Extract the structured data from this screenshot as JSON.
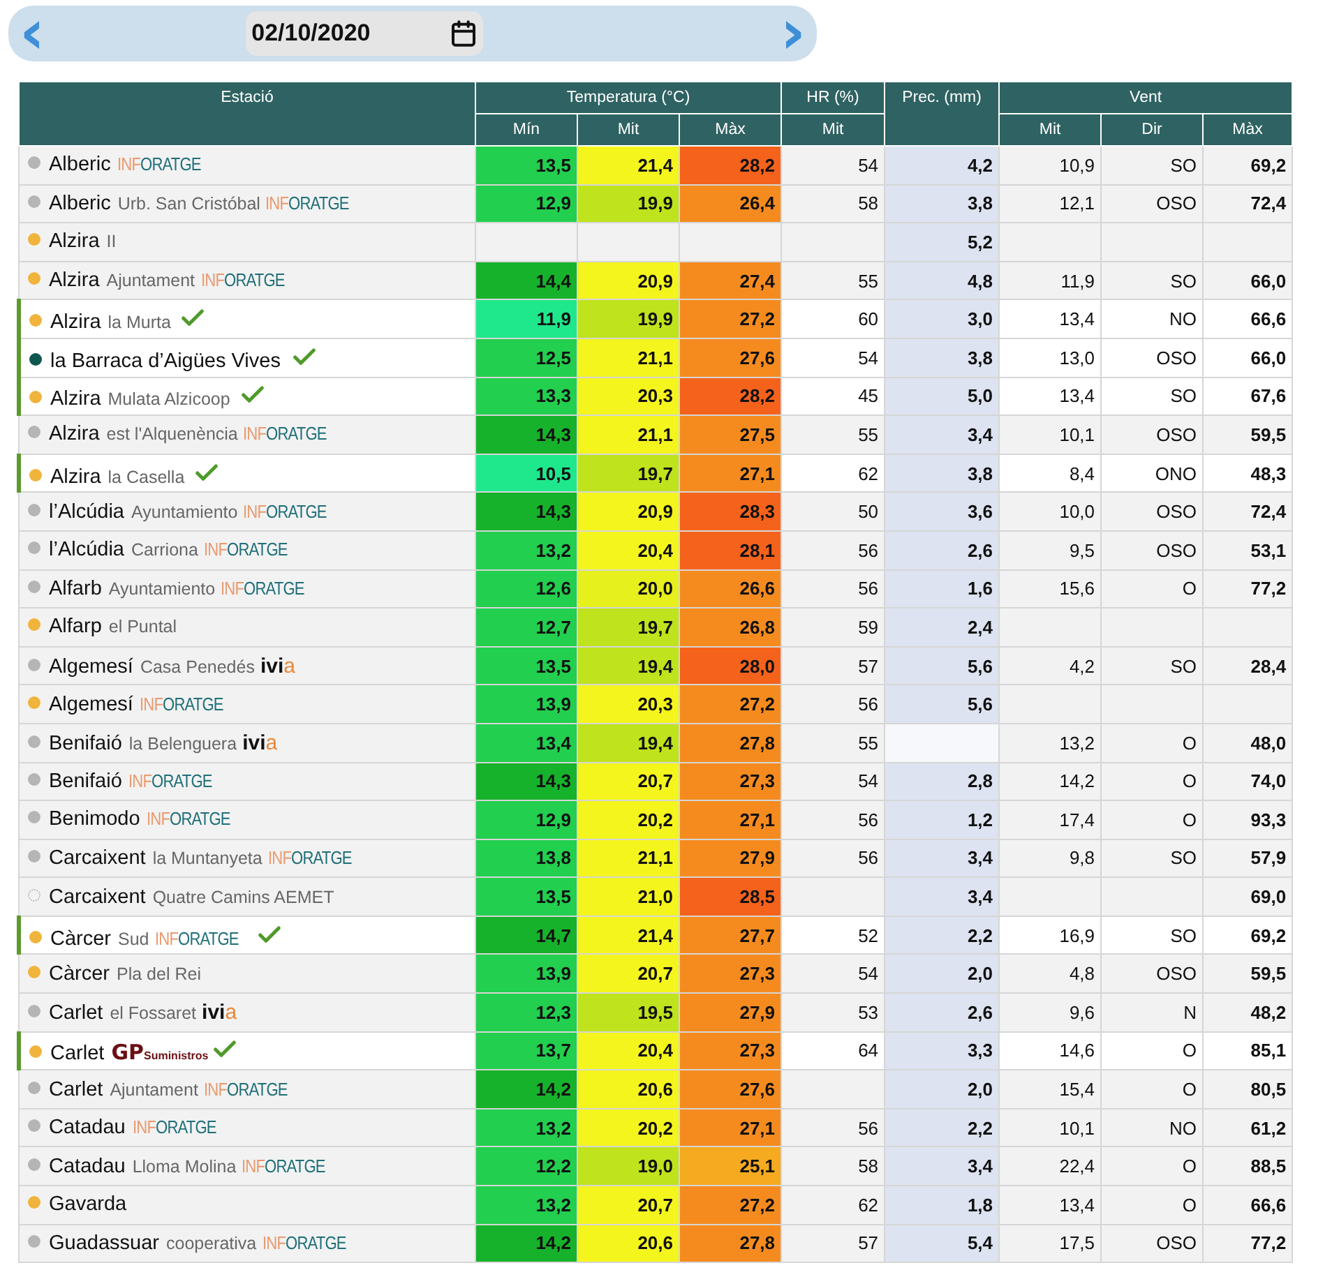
{
  "date_bar": {
    "prev": "‹",
    "date": "02/10/2020",
    "next": "›"
  },
  "table": {
    "columns": {
      "station": "Estació",
      "temperature": "Temperatura (°C)",
      "humidity": "HR (%)",
      "precipitation": "Prec. (mm)",
      "wind": "Vent",
      "sub": [
        "Mín",
        "Mit",
        "Màx",
        "Mit",
        "Mit",
        "Dir",
        "Màx"
      ]
    },
    "rows": [
      {
        "name": "Alberic",
        "place": null,
        "brand": {
          "kind": "inforatge",
          "lead": "INF",
          "rest": "ORATGE"
        },
        "color": "#b5b5b5",
        "dashed": false,
        "verified": false,
        "min": {
          "value": "13,5",
          "color": "#22cf4e"
        },
        "mit": {
          "value": "21,4",
          "color": "#f4f51c"
        },
        "max": {
          "value": "28,2",
          "color": "#f5621b"
        },
        "hr": "54",
        "prec": "4,2",
        "wind_mit": "10,9",
        "wind_dir": "SO",
        "wind_max": "69,2"
      },
      {
        "name": "Alberic",
        "place": "Urb. San Cristóbal",
        "brand": {
          "kind": "inforatge",
          "lead": "INF",
          "rest": "ORATGE"
        },
        "color": "#b5b5b5",
        "dashed": false,
        "verified": false,
        "min": {
          "value": "12,9",
          "color": "#22cf4e"
        },
        "mit": {
          "value": "19,9",
          "color": "#bfe31c"
        },
        "max": {
          "value": "26,4",
          "color": "#f58b1f"
        },
        "hr": "58",
        "prec": "3,8",
        "wind_mit": "12,1",
        "wind_dir": "OSO",
        "wind_max": "72,4"
      },
      {
        "name": "Alzira",
        "place": "II",
        "brand": null,
        "color": "#f0b43c",
        "dashed": false,
        "verified": false,
        "min": null,
        "mit": null,
        "max": null,
        "hr": null,
        "prec": "5,2",
        "wind_mit": null,
        "wind_dir": null,
        "wind_max": null
      },
      {
        "name": "Alzira",
        "place": "Ajuntament",
        "brand": {
          "kind": "inforatge",
          "lead": "INF",
          "rest": "ORATGE"
        },
        "color": "#f0b43c",
        "dashed": false,
        "verified": false,
        "min": {
          "value": "14,4",
          "color": "#17b22b"
        },
        "mit": {
          "value": "20,9",
          "color": "#f4f51c"
        },
        "max": {
          "value": "27,4",
          "color": "#f58b1f"
        },
        "hr": "55",
        "prec": "4,8",
        "wind_mit": "11,9",
        "wind_dir": "SO",
        "wind_max": "66,0"
      },
      {
        "name": "Alzira",
        "place": "la Murta",
        "brand": null,
        "color": "#f0b43c",
        "dashed": false,
        "verified": true,
        "min": {
          "value": "11,9",
          "color": "#1fe88c"
        },
        "mit": {
          "value": "19,9",
          "color": "#bfe31c"
        },
        "max": {
          "value": "27,2",
          "color": "#f58b1f"
        },
        "hr": "60",
        "prec": "3,0",
        "wind_mit": "13,4",
        "wind_dir": "NO",
        "wind_max": "66,6"
      },
      {
        "name": "la Barraca d’Aigües Vives",
        "place": null,
        "brand": null,
        "color": "#0e5550",
        "dashed": false,
        "verified": true,
        "min": {
          "value": "12,5",
          "color": "#22cf4e"
        },
        "mit": {
          "value": "21,1",
          "color": "#f4f51c"
        },
        "max": {
          "value": "27,6",
          "color": "#f58b1f"
        },
        "hr": "54",
        "prec": "3,8",
        "wind_mit": "13,0",
        "wind_dir": "OSO",
        "wind_max": "66,0"
      },
      {
        "name": "Alzira",
        "place": "Mulata Alzicoop",
        "brand": null,
        "color": "#f0b43c",
        "dashed": false,
        "verified": true,
        "min": {
          "value": "13,3",
          "color": "#22cf4e"
        },
        "mit": {
          "value": "20,3",
          "color": "#f4f51c"
        },
        "max": {
          "value": "28,2",
          "color": "#f5621b"
        },
        "hr": "45",
        "prec": "5,0",
        "wind_mit": "13,4",
        "wind_dir": "SO",
        "wind_max": "67,6"
      },
      {
        "name": "Alzira",
        "place": "est l'Alquenència",
        "brand": {
          "kind": "inforatge",
          "lead": "INF",
          "rest": "ORATGE"
        },
        "color": "#b5b5b5",
        "dashed": false,
        "verified": false,
        "min": {
          "value": "14,3",
          "color": "#17b22b"
        },
        "mit": {
          "value": "21,1",
          "color": "#f4f51c"
        },
        "max": {
          "value": "27,5",
          "color": "#f58b1f"
        },
        "hr": "55",
        "prec": "3,4",
        "wind_mit": "10,1",
        "wind_dir": "OSO",
        "wind_max": "59,5"
      },
      {
        "name": "Alzira",
        "place": "la Casella",
        "brand": null,
        "color": "#f0b43c",
        "dashed": false,
        "verified": true,
        "min": {
          "value": "10,5",
          "color": "#1fe88c"
        },
        "mit": {
          "value": "19,7",
          "color": "#bfe31c"
        },
        "max": {
          "value": "27,1",
          "color": "#f58b1f"
        },
        "hr": "62",
        "prec": "3,8",
        "wind_mit": "8,4",
        "wind_dir": "ONO",
        "wind_max": "48,3"
      },
      {
        "name": "l’Alcúdia",
        "place": "Ayuntamiento",
        "brand": {
          "kind": "inforatge",
          "lead": "INF",
          "rest": "ORATGE"
        },
        "color": "#b5b5b5",
        "dashed": false,
        "verified": false,
        "min": {
          "value": "14,3",
          "color": "#17b22b"
        },
        "mit": {
          "value": "20,9",
          "color": "#f4f51c"
        },
        "max": {
          "value": "28,3",
          "color": "#f5621b"
        },
        "hr": "50",
        "prec": "3,6",
        "wind_mit": "10,0",
        "wind_dir": "OSO",
        "wind_max": "72,4"
      },
      {
        "name": "l’Alcúdia",
        "place": "Carriona",
        "brand": {
          "kind": "inforatge",
          "lead": "INF",
          "rest": "ORATGE"
        },
        "color": "#b5b5b5",
        "dashed": false,
        "verified": false,
        "min": {
          "value": "13,2",
          "color": "#22cf4e"
        },
        "mit": {
          "value": "20,4",
          "color": "#f4f51c"
        },
        "max": {
          "value": "28,1",
          "color": "#f5621b"
        },
        "hr": "56",
        "prec": "2,6",
        "wind_mit": "9,5",
        "wind_dir": "OSO",
        "wind_max": "53,1"
      },
      {
        "name": "Alfarb",
        "place": "Ayuntamiento",
        "brand": {
          "kind": "inforatge",
          "lead": "INF",
          "rest": "ORATGE"
        },
        "color": "#b5b5b5",
        "dashed": false,
        "verified": false,
        "min": {
          "value": "12,6",
          "color": "#22cf4e"
        },
        "mit": {
          "value": "20,0",
          "color": "#e6f01c"
        },
        "max": {
          "value": "26,6",
          "color": "#f58b1f"
        },
        "hr": "56",
        "prec": "1,6",
        "wind_mit": "15,6",
        "wind_dir": "O",
        "wind_max": "77,2"
      },
      {
        "name": "Alfarp",
        "place": "el Puntal",
        "brand": null,
        "color": "#f0b43c",
        "dashed": false,
        "verified": false,
        "min": {
          "value": "12,7",
          "color": "#22cf4e"
        },
        "mit": {
          "value": "19,7",
          "color": "#bfe31c"
        },
        "max": {
          "value": "26,8",
          "color": "#f58b1f"
        },
        "hr": "59",
        "prec": "2,4",
        "wind_mit": null,
        "wind_dir": null,
        "wind_max": null
      },
      {
        "name": "Algemesí",
        "place": "Casa Penedés",
        "brand": {
          "kind": "ivia",
          "lead": "ivi",
          "rest": "a"
        },
        "color": "#b5b5b5",
        "dashed": false,
        "verified": false,
        "min": {
          "value": "13,5",
          "color": "#22cf4e"
        },
        "mit": {
          "value": "19,4",
          "color": "#bfe31c"
        },
        "max": {
          "value": "28,0",
          "color": "#f5621b"
        },
        "hr": "57",
        "prec": "5,6",
        "wind_mit": "4,2",
        "wind_dir": "SO",
        "wind_max": "28,4"
      },
      {
        "name": "Algemesí",
        "place": null,
        "brand": {
          "kind": "inforatge",
          "lead": "INF",
          "rest": "ORATGE"
        },
        "color": "#f0b43c",
        "dashed": false,
        "verified": false,
        "min": {
          "value": "13,9",
          "color": "#22cf4e"
        },
        "mit": {
          "value": "20,3",
          "color": "#f4f51c"
        },
        "max": {
          "value": "27,2",
          "color": "#f58b1f"
        },
        "hr": "56",
        "prec": "5,6",
        "wind_mit": null,
        "wind_dir": null,
        "wind_max": null
      },
      {
        "name": "Benifaió",
        "place": "la Belenguera",
        "brand": {
          "kind": "ivia",
          "lead": "ivi",
          "rest": "a"
        },
        "color": "#b5b5b5",
        "dashed": false,
        "verified": false,
        "min": {
          "value": "13,4",
          "color": "#22cf4e"
        },
        "mit": {
          "value": "19,4",
          "color": "#bfe31c"
        },
        "max": {
          "value": "27,8",
          "color": "#f58b1f"
        },
        "hr": "55",
        "prec": null,
        "wind_mit": "13,2",
        "wind_dir": "O",
        "wind_max": "48,0"
      },
      {
        "name": "Benifaió",
        "place": null,
        "brand": {
          "kind": "inforatge",
          "lead": "INF",
          "rest": "ORATGE"
        },
        "color": "#b5b5b5",
        "dashed": false,
        "verified": false,
        "min": {
          "value": "14,3",
          "color": "#17b22b"
        },
        "mit": {
          "value": "20,7",
          "color": "#f4f51c"
        },
        "max": {
          "value": "27,3",
          "color": "#f58b1f"
        },
        "hr": "54",
        "prec": "2,8",
        "wind_mit": "14,2",
        "wind_dir": "O",
        "wind_max": "74,0"
      },
      {
        "name": "Benimodo",
        "place": null,
        "brand": {
          "kind": "inforatge",
          "lead": "INF",
          "rest": "ORATGE"
        },
        "color": "#b5b5b5",
        "dashed": false,
        "verified": false,
        "min": {
          "value": "12,9",
          "color": "#22cf4e"
        },
        "mit": {
          "value": "20,2",
          "color": "#f4f51c"
        },
        "max": {
          "value": "27,1",
          "color": "#f58b1f"
        },
        "hr": "56",
        "prec": "1,2",
        "wind_mit": "17,4",
        "wind_dir": "O",
        "wind_max": "93,3"
      },
      {
        "name": "Carcaixent",
        "place": "la Muntanyeta",
        "brand": {
          "kind": "inforatge",
          "lead": "INF",
          "rest": "ORATGE"
        },
        "color": "#b5b5b5",
        "dashed": false,
        "verified": false,
        "min": {
          "value": "13,8",
          "color": "#22cf4e"
        },
        "mit": {
          "value": "21,1",
          "color": "#f4f51c"
        },
        "max": {
          "value": "27,9",
          "color": "#f58b1f"
        },
        "hr": "56",
        "prec": "3,4",
        "wind_mit": "9,8",
        "wind_dir": "SO",
        "wind_max": "57,9"
      },
      {
        "name": "Carcaixent",
        "place": "Quatre Camins AEMET",
        "brand": null,
        "color": "#b5b5b5",
        "dashed": true,
        "verified": false,
        "min": {
          "value": "13,5",
          "color": "#22cf4e"
        },
        "mit": {
          "value": "21,0",
          "color": "#f4f51c"
        },
        "max": {
          "value": "28,5",
          "color": "#f5621b"
        },
        "hr": null,
        "prec": "3,4",
        "wind_mit": null,
        "wind_dir": null,
        "wind_max": "69,0"
      },
      {
        "name": "Càrcer",
        "place": "Sud",
        "brand": {
          "kind": "inforatge",
          "lead": "INF",
          "rest": "ORATGE"
        },
        "color": "#f0b43c",
        "dashed": false,
        "verified": true,
        "min": {
          "value": "14,7",
          "color": "#17b22b"
        },
        "mit": {
          "value": "21,4",
          "color": "#f4f51c"
        },
        "max": {
          "value": "27,7",
          "color": "#f58b1f"
        },
        "hr": "52",
        "prec": "2,2",
        "wind_mit": "16,9",
        "wind_dir": "SO",
        "wind_max": "69,2"
      },
      {
        "name": "Càrcer",
        "place": "Pla del Rei",
        "brand": null,
        "color": "#f0b43c",
        "dashed": false,
        "verified": false,
        "min": {
          "value": "13,9",
          "color": "#22cf4e"
        },
        "mit": {
          "value": "20,7",
          "color": "#f4f51c"
        },
        "max": {
          "value": "27,3",
          "color": "#f58b1f"
        },
        "hr": "54",
        "prec": "2,0",
        "wind_mit": "4,8",
        "wind_dir": "OSO",
        "wind_max": "59,5"
      },
      {
        "name": "Carlet",
        "place": "el Fossaret",
        "brand": {
          "kind": "ivia",
          "lead": "ivi",
          "rest": "a"
        },
        "color": "#b5b5b5",
        "dashed": false,
        "verified": false,
        "min": {
          "value": "12,3",
          "color": "#22cf4e"
        },
        "mit": {
          "value": "19,5",
          "color": "#bfe31c"
        },
        "max": {
          "value": "27,9",
          "color": "#f58b1f"
        },
        "hr": "53",
        "prec": "2,6",
        "wind_mit": "9,6",
        "wind_dir": "N",
        "wind_max": "48,2"
      },
      {
        "name": "Carlet",
        "place": null,
        "brand": {
          "kind": "gp",
          "lead": "GP",
          "rest": "Suministros"
        },
        "color": "#f0b43c",
        "dashed": false,
        "verified": true,
        "min": {
          "value": "13,7",
          "color": "#22cf4e"
        },
        "mit": {
          "value": "20,4",
          "color": "#f4f51c"
        },
        "max": {
          "value": "27,3",
          "color": "#f58b1f"
        },
        "hr": "64",
        "prec": "3,3",
        "wind_mit": "14,6",
        "wind_dir": "O",
        "wind_max": "85,1"
      },
      {
        "name": "Carlet",
        "place": "Ajuntament",
        "brand": {
          "kind": "inforatge",
          "lead": "INF",
          "rest": "ORATGE"
        },
        "color": "#b5b5b5",
        "dashed": false,
        "verified": false,
        "min": {
          "value": "14,2",
          "color": "#17b22b"
        },
        "mit": {
          "value": "20,6",
          "color": "#f4f51c"
        },
        "max": {
          "value": "27,6",
          "color": "#f58b1f"
        },
        "hr": null,
        "prec": "2,0",
        "wind_mit": "15,4",
        "wind_dir": "O",
        "wind_max": "80,5"
      },
      {
        "name": "Catadau",
        "place": null,
        "brand": {
          "kind": "inforatge",
          "lead": "INF",
          "rest": "ORATGE"
        },
        "color": "#b5b5b5",
        "dashed": false,
        "verified": false,
        "min": {
          "value": "13,2",
          "color": "#22cf4e"
        },
        "mit": {
          "value": "20,2",
          "color": "#f4f51c"
        },
        "max": {
          "value": "27,1",
          "color": "#f58b1f"
        },
        "hr": "56",
        "prec": "2,2",
        "wind_mit": "10,1",
        "wind_dir": "NO",
        "wind_max": "61,2"
      },
      {
        "name": "Catadau",
        "place": "Lloma Molina",
        "brand": {
          "kind": "inforatge",
          "lead": "INF",
          "rest": "ORATGE"
        },
        "color": "#b5b5b5",
        "dashed": false,
        "verified": false,
        "min": {
          "value": "12,2",
          "color": "#22cf4e"
        },
        "mit": {
          "value": "19,0",
          "color": "#bfe31c"
        },
        "max": {
          "value": "25,1",
          "color": "#f5aa20"
        },
        "hr": "58",
        "prec": "3,4",
        "wind_mit": "22,4",
        "wind_dir": "O",
        "wind_max": "88,5"
      },
      {
        "name": "Gavarda",
        "place": null,
        "brand": null,
        "color": "#f0b43c",
        "dashed": false,
        "verified": false,
        "min": {
          "value": "13,2",
          "color": "#22cf4e"
        },
        "mit": {
          "value": "20,7",
          "color": "#f4f51c"
        },
        "max": {
          "value": "27,2",
          "color": "#f58b1f"
        },
        "hr": "62",
        "prec": "1,8",
        "wind_mit": "13,4",
        "wind_dir": "O",
        "wind_max": "66,6"
      },
      {
        "name": "Guadassuar",
        "place": "cooperativa",
        "brand": {
          "kind": "inforatge",
          "lead": "INF",
          "rest": "ORATGE"
        },
        "color": "#b5b5b5",
        "dashed": false,
        "verified": false,
        "min": {
          "value": "14,2",
          "color": "#17b22b"
        },
        "mit": {
          "value": "20,6",
          "color": "#f4f51c"
        },
        "max": {
          "value": "27,8",
          "color": "#f58b1f"
        },
        "hr": "57",
        "prec": "5,4",
        "wind_mit": "17,5",
        "wind_dir": "OSO",
        "wind_max": "77,2"
      }
    ]
  }
}
